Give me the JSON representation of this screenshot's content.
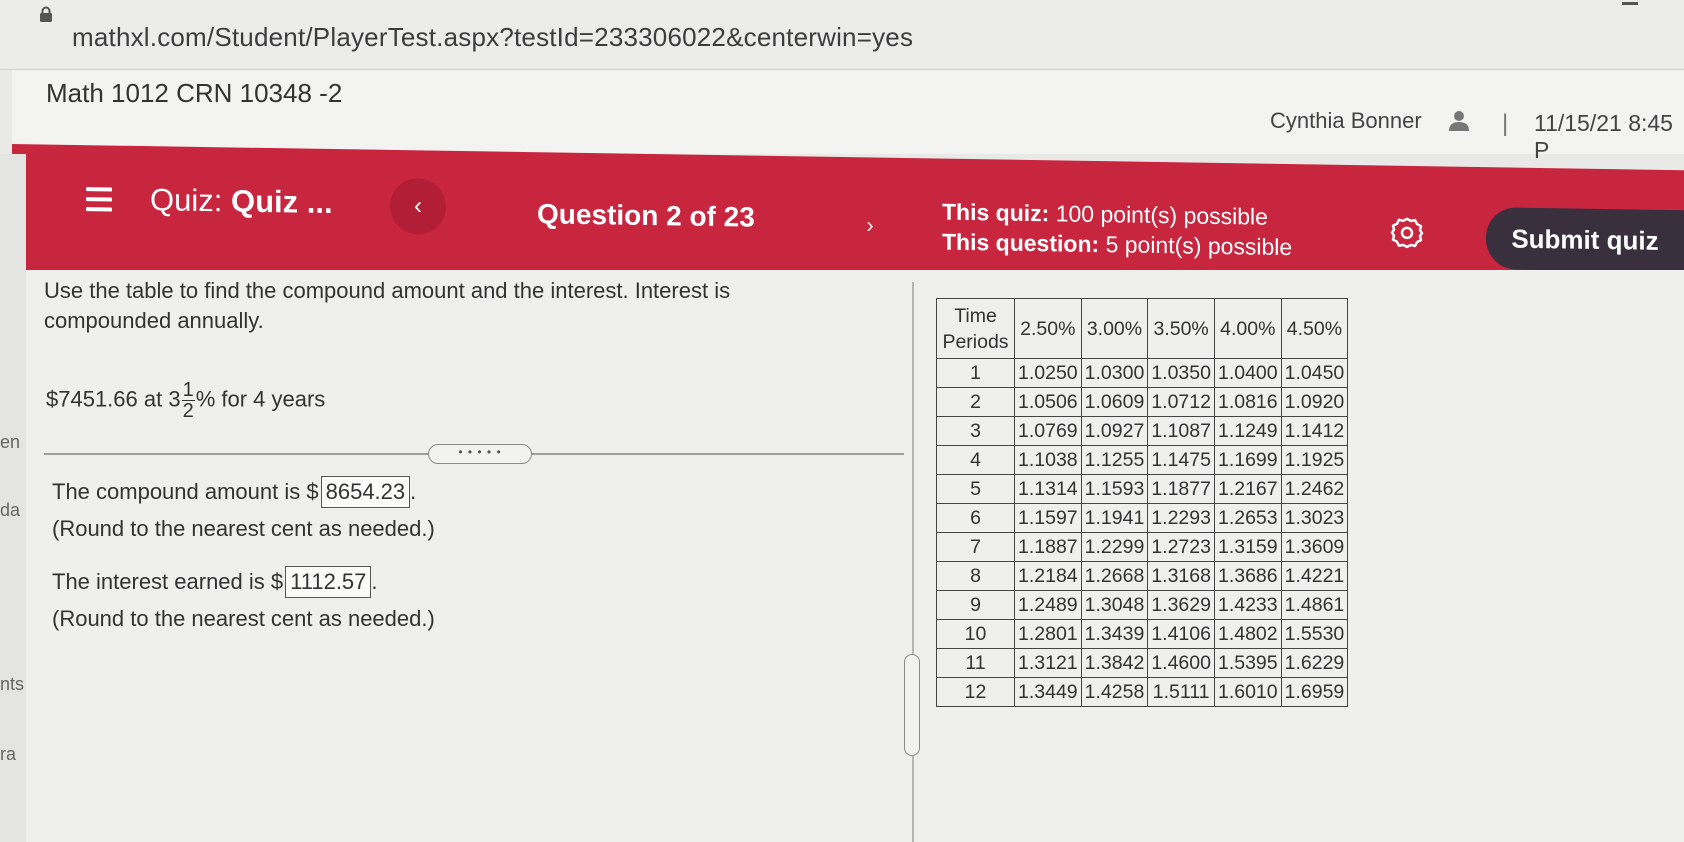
{
  "browser": {
    "url": "mathxl.com/Student/PlayerTest.aspx?testId=233306022&centerwin=yes"
  },
  "course": {
    "title": "Math 1012 CRN 10348 -2",
    "user_name": "Cynthia Bonner",
    "separator": "|",
    "datetime": "11/15/21 8:45 P"
  },
  "quiz_bar": {
    "quiz_prefix": "Quiz:",
    "quiz_name": "Quiz ...",
    "prev_label": "‹",
    "question_counter": "Question 2 of 23",
    "next_label": "›",
    "quiz_points_label": "This quiz:",
    "quiz_points_value": "100 point(s) possible",
    "question_points_label": "This question:",
    "question_points_value": "5 point(s) possible",
    "submit_label": "Submit quiz"
  },
  "question": {
    "instruction": "Use the table to find the compound amount and the interest. Interest is compounded annually.",
    "principal": "$7451.66 at 3",
    "fraction_num": "1",
    "fraction_den": "2",
    "rate_suffix": "% for 4 years",
    "more_handle": "• • • • •",
    "compound_label": "The compound amount is $",
    "compound_value": "8654.23",
    "compound_hint": "(Round to the nearest cent as needed.)",
    "interest_label": "The interest earned is $",
    "interest_value": "1112.57",
    "interest_hint": "(Round to the nearest cent as needed.)",
    "trailing_period": "."
  },
  "left_edge": {
    "fragments": [
      "en",
      "da",
      "nts",
      "ra"
    ]
  },
  "table": {
    "period_header": "Time Periods",
    "rate_headers": [
      "2.50%",
      "3.00%",
      "3.50%",
      "4.00%",
      "4.50%"
    ],
    "rows": [
      {
        "period": "1",
        "values": [
          "1.0250",
          "1.0300",
          "1.0350",
          "1.0400",
          "1.0450"
        ]
      },
      {
        "period": "2",
        "values": [
          "1.0506",
          "1.0609",
          "1.0712",
          "1.0816",
          "1.0920"
        ]
      },
      {
        "period": "3",
        "values": [
          "1.0769",
          "1.0927",
          "1.1087",
          "1.1249",
          "1.1412"
        ]
      },
      {
        "period": "4",
        "values": [
          "1.1038",
          "1.1255",
          "1.1475",
          "1.1699",
          "1.1925"
        ]
      },
      {
        "period": "5",
        "values": [
          "1.1314",
          "1.1593",
          "1.1877",
          "1.2167",
          "1.2462"
        ]
      },
      {
        "period": "6",
        "values": [
          "1.1597",
          "1.1941",
          "1.2293",
          "1.2653",
          "1.3023"
        ]
      },
      {
        "period": "7",
        "values": [
          "1.1887",
          "1.2299",
          "1.2723",
          "1.3159",
          "1.3609"
        ]
      },
      {
        "period": "8",
        "values": [
          "1.2184",
          "1.2668",
          "1.3168",
          "1.3686",
          "1.4221"
        ]
      },
      {
        "period": "9",
        "values": [
          "1.2489",
          "1.3048",
          "1.3629",
          "1.4233",
          "1.4861"
        ]
      },
      {
        "period": "10",
        "values": [
          "1.2801",
          "1.3439",
          "1.4106",
          "1.4802",
          "1.5530"
        ]
      },
      {
        "period": "11",
        "values": [
          "1.3121",
          "1.3842",
          "1.4600",
          "1.5395",
          "1.6229"
        ]
      },
      {
        "period": "12",
        "values": [
          "1.3449",
          "1.4258",
          "1.5111",
          "1.6010",
          "1.6959"
        ]
      }
    ]
  },
  "colors": {
    "quiz_bar": "#c8253f",
    "submit_button": "#3a2f3d",
    "page_background": "#efefed"
  },
  "icons": {
    "lock": "lock-icon",
    "menu": "hamburger-menu-icon",
    "user": "user-icon",
    "settings": "gear-icon"
  }
}
